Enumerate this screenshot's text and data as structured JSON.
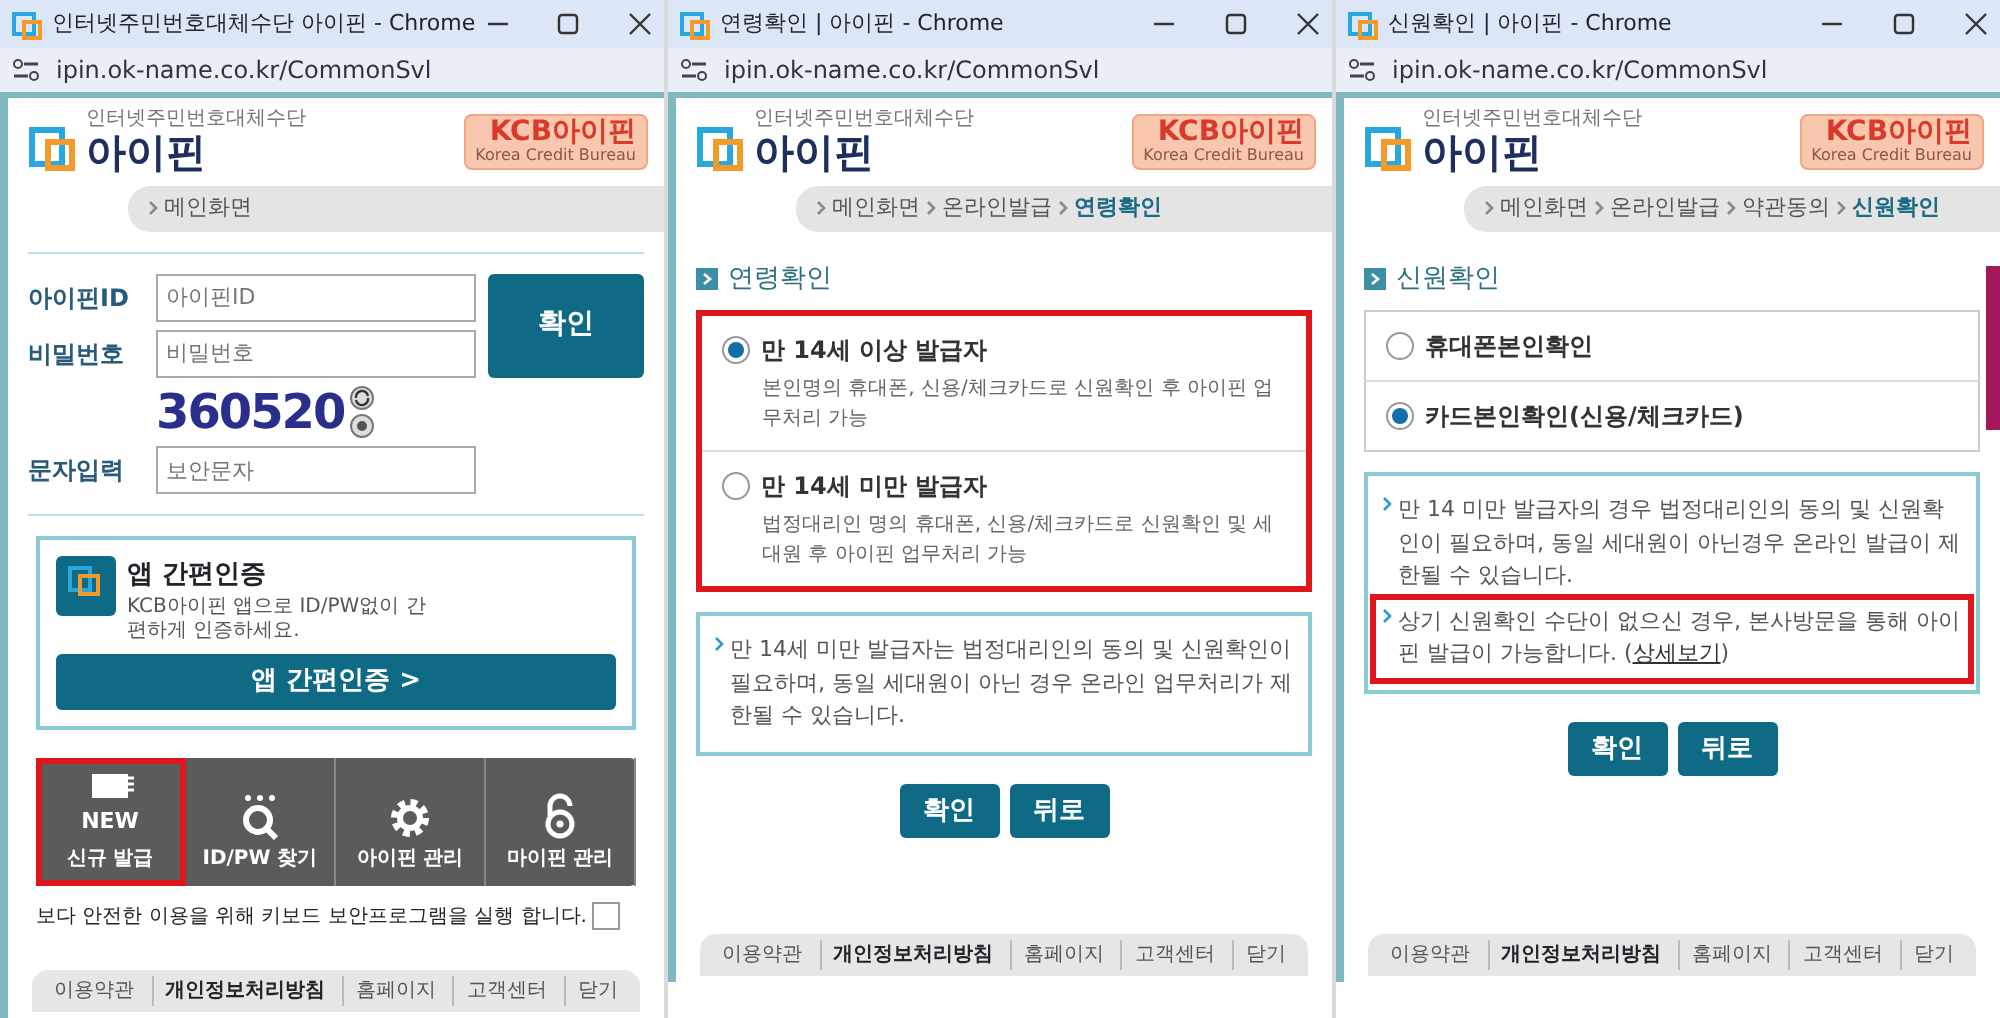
{
  "windows": [
    {
      "kind": "login",
      "title": "인터넷주민번호대체수단 아이핀 - Chrome",
      "url": "ipin.ok-name.co.kr/CommonSvl",
      "logo": {
        "caption": "인터넷주민번호대체수단",
        "name": "아이핀"
      },
      "kcb": {
        "name": "KCB아이핀",
        "sub": "Korea Credit Bureau"
      },
      "breadcrumb": [
        {
          "label": "메인화면",
          "current": false
        }
      ],
      "fields": [
        {
          "label": "아이핀ID",
          "placeholder": "아이핀ID"
        },
        {
          "label": "비밀번호",
          "placeholder": "비밀번호"
        }
      ],
      "submit": "확인",
      "captcha": "360520",
      "captcha_field": {
        "label": "문자입력",
        "placeholder": "보안문자"
      },
      "app_card": {
        "title": "앱 간편인증",
        "desc": "KCB아이핀 앱으로 ID/PW없이 간편하게 인증하세요.",
        "button": "앱 간편인증 >"
      },
      "tiles": [
        {
          "kind": "issue",
          "badge": "NEW",
          "label": "신규 발급",
          "highlighted": true
        },
        {
          "kind": "find",
          "label": "ID/PW 찾기",
          "highlighted": false
        },
        {
          "kind": "manage",
          "label": "아이핀 관리",
          "highlighted": false
        },
        {
          "kind": "mypin",
          "label": "마이핀 관리",
          "highlighted": false
        }
      ],
      "keyboard": {
        "text": "보다 안전한 이용을 위해 키보드 보안프로그램을 실행 합니다.",
        "checked": false
      },
      "footer": [
        {
          "label": "이용약관",
          "emphasized": false
        },
        {
          "label": "개인정보처리방침",
          "emphasized": true
        },
        {
          "label": "홈페이지",
          "emphasized": false
        },
        {
          "label": "고객센터",
          "emphasized": false
        },
        {
          "label": "닫기",
          "emphasized": false
        }
      ]
    },
    {
      "kind": "choice",
      "title": "연령확인 | 아이핀 - Chrome",
      "url": "ipin.ok-name.co.kr/CommonSvl",
      "logo": {
        "caption": "인터넷주민번호대체수단",
        "name": "아이핀"
      },
      "kcb": {
        "name": "KCB아이핀",
        "sub": "Korea Credit Bureau"
      },
      "breadcrumb": [
        {
          "label": "메인화면",
          "current": false
        },
        {
          "label": "온라인발급",
          "current": false
        },
        {
          "label": "연령확인",
          "current": true
        }
      ],
      "section": "연령확인",
      "options_highlighted": true,
      "options": [
        {
          "title": "만 14세 이상 발급자",
          "desc": "본인명의 휴대폰, 신용/체크카드로 신원확인 후 아이핀 업무처리 가능",
          "selected": true
        },
        {
          "title": "만 14세 미만 발급자",
          "desc": "법정대리인 명의 휴대폰, 신용/체크카드로 신원확인 및 세대원 후 아이핀 업무처리 가능",
          "selected": false
        }
      ],
      "notices": [
        {
          "text": "만 14세 미만 발급자는 법정대리인의 동의 및 신원확인이 필요하며, 동일 세대원이 아닌 경우 온라인 업무처리가 제한될 수 있습니다.",
          "highlighted": false
        }
      ],
      "buttons": [
        "확인",
        "뒤로"
      ],
      "footer": [
        {
          "label": "이용약관",
          "emphasized": false
        },
        {
          "label": "개인정보처리방침",
          "emphasized": true
        },
        {
          "label": "홈페이지",
          "emphasized": false
        },
        {
          "label": "고객센터",
          "emphasized": false
        },
        {
          "label": "닫기",
          "emphasized": false
        }
      ]
    },
    {
      "kind": "choice",
      "title": "신원확인 | 아이핀 - Chrome",
      "url": "ipin.ok-name.co.kr/CommonSvl",
      "logo": {
        "caption": "인터넷주민번호대체수단",
        "name": "아이핀"
      },
      "kcb": {
        "name": "KCB아이핀",
        "sub": "Korea Credit Bureau"
      },
      "breadcrumb": [
        {
          "label": "메인화면",
          "current": false
        },
        {
          "label": "온라인발급",
          "current": false
        },
        {
          "label": "약관동의",
          "current": false
        },
        {
          "label": "신원확인",
          "current": true
        }
      ],
      "section": "신원확인",
      "options_highlighted": false,
      "options": [
        {
          "title": "휴대폰본인확인",
          "selected": false
        },
        {
          "title": "카드본인확인(신용/체크카드)",
          "selected": true
        }
      ],
      "notices": [
        {
          "text": "만 14 미만 발급자의 경우 법정대리인의 동의 및 신원확인이 필요하며, 동일 세대원이 아닌경우 온라인 발급이 제한될 수 있습니다.",
          "highlighted": false
        },
        {
          "text": "상기 신원확인 수단이 없으신 경우, 본사방문을 통해 아이핀 발급이 가능합니다. (",
          "link": "상세보기",
          "after": ")",
          "highlighted": true
        }
      ],
      "buttons": [
        "확인",
        "뒤로"
      ],
      "footer": [
        {
          "label": "이용약관",
          "emphasized": false
        },
        {
          "label": "개인정보처리방침",
          "emphasized": true
        },
        {
          "label": "홈페이지",
          "emphasized": false
        },
        {
          "label": "고객센터",
          "emphasized": false
        },
        {
          "label": "닫기",
          "emphasized": false
        }
      ]
    }
  ]
}
